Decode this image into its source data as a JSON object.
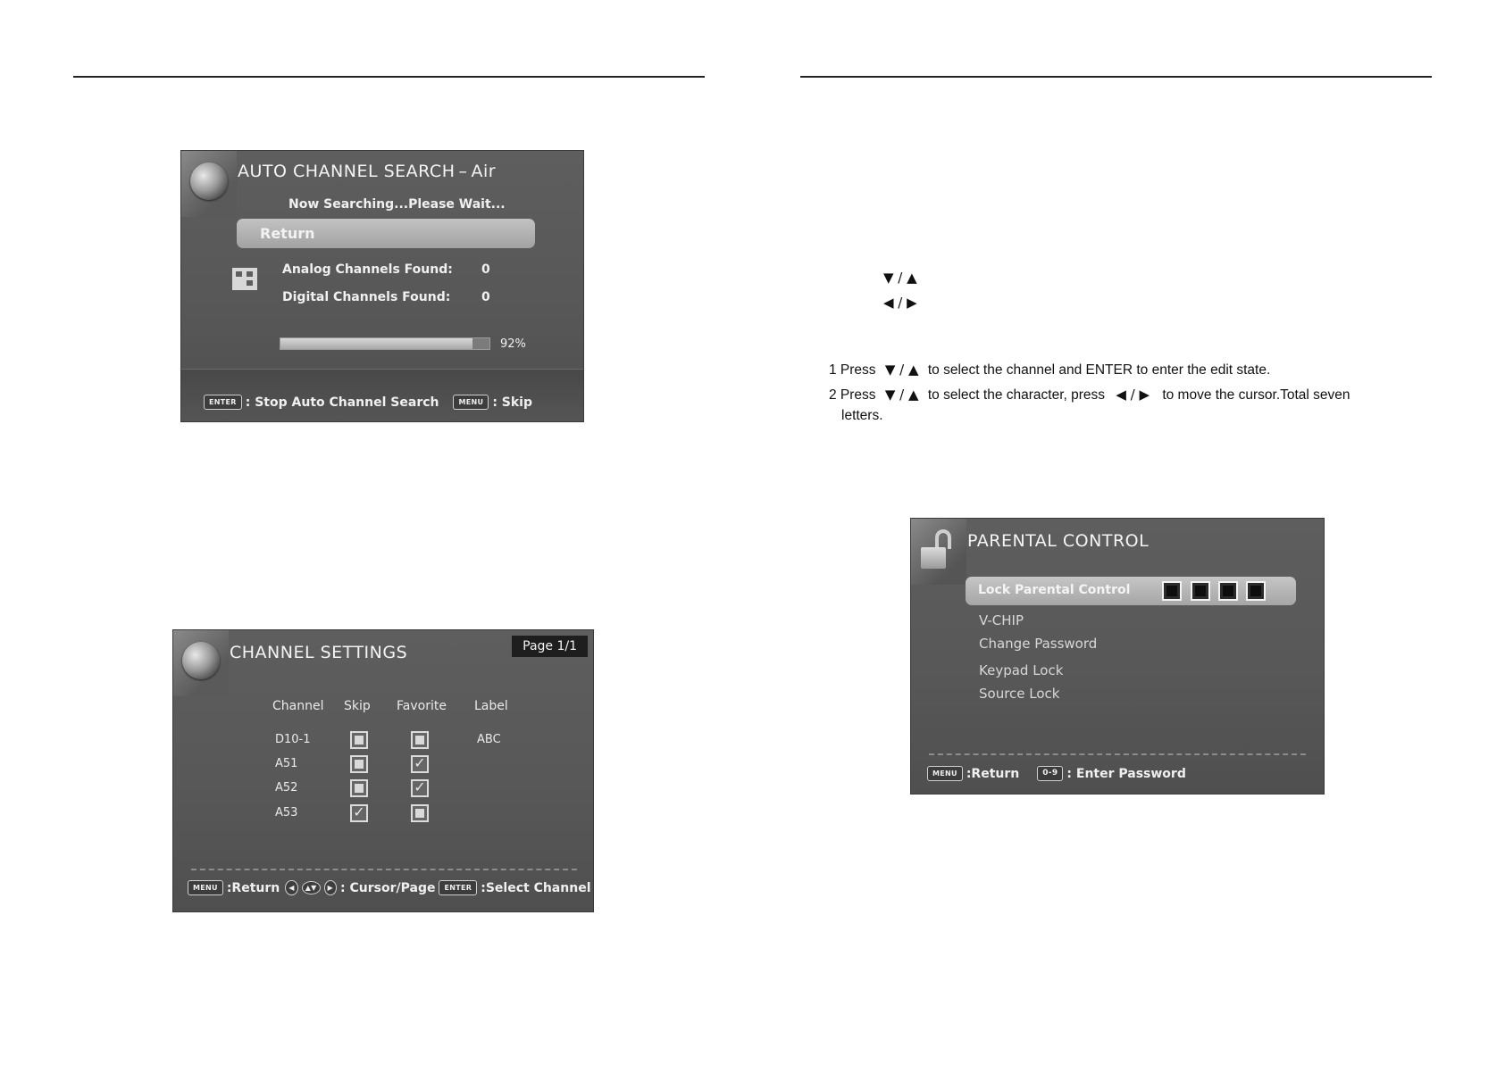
{
  "screen_search": {
    "title": "AUTO CHANNEL SEARCH",
    "title_suffix": "Air",
    "status": "Now Searching...Please Wait...",
    "return_label": "Return",
    "analog_label": "Analog Channels Found:",
    "analog_value": "0",
    "digital_label": "Digital Channels Found:",
    "digital_value": "0",
    "progress_percent": 92,
    "progress_text": "92%",
    "footer": {
      "enter_key": "ENTER",
      "enter_action": ": Stop Auto Channel Search",
      "menu_key": "MENU",
      "menu_action": ": Skip"
    }
  },
  "screen_channels": {
    "title": "CHANNEL SETTINGS",
    "page": "Page 1/1",
    "columns": [
      "Channel",
      "Skip",
      "Favorite",
      "Label"
    ],
    "rows": [
      {
        "channel": "D10-1",
        "skip": false,
        "favorite": false,
        "label": "ABC"
      },
      {
        "channel": "A51",
        "skip": false,
        "favorite": true,
        "label": ""
      },
      {
        "channel": "A52",
        "skip": false,
        "favorite": true,
        "label": ""
      },
      {
        "channel": "A53",
        "skip": true,
        "favorite": false,
        "label": ""
      }
    ],
    "footer": {
      "menu_key": "MENU",
      "menu_action": ":Return",
      "cursor_action": ": Cursor/Page",
      "enter_key": "ENTER",
      "enter_action": ":Select Channel"
    }
  },
  "instructions": {
    "updown_symbol": "▼ / ▲",
    "leftright_symbol": "◀ / ▶",
    "step1_prefix": "1 Press",
    "step1_text": "to select the channel and ENTER to enter the edit state.",
    "step2_prefix": "2 Press",
    "step2_mid": "to select the character, press",
    "step2_text": "to move the cursor.Total seven",
    "step2_cont": "letters."
  },
  "screen_parental": {
    "title": "PARENTAL CONTROL",
    "selected_item": "Lock Parental Control",
    "items": [
      "V-CHIP",
      "Change Password",
      "Keypad Lock",
      "Source Lock"
    ],
    "footer": {
      "menu_key": "MENU",
      "menu_action": ":Return",
      "num_key": "0-9",
      "num_action": ": Enter Password"
    }
  },
  "colors": {
    "osd_bg": "#5a5a5a",
    "highlight": "#b4b4b4",
    "page_text": "#111111"
  }
}
